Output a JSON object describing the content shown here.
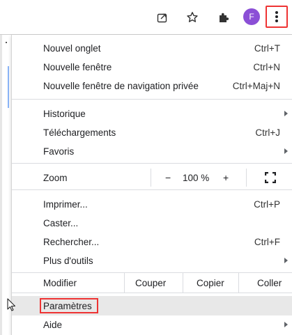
{
  "toolbar": {
    "share_icon": "share-icon",
    "star_icon": "star-icon",
    "extensions_icon": "puzzle-icon",
    "avatar_letter": "F",
    "avatar_color": "#8b4fd6",
    "menu_icon": "kebab-menu-icon"
  },
  "menu": {
    "new_tab": {
      "label": "Nouvel onglet",
      "shortcut": "Ctrl+T"
    },
    "new_window": {
      "label": "Nouvelle fenêtre",
      "shortcut": "Ctrl+N"
    },
    "incognito": {
      "label": "Nouvelle fenêtre de navigation privée",
      "shortcut": "Ctrl+Maj+N"
    },
    "history": {
      "label": "Historique"
    },
    "downloads": {
      "label": "Téléchargements",
      "shortcut": "Ctrl+J"
    },
    "bookmarks": {
      "label": "Favoris"
    },
    "zoom": {
      "label": "Zoom",
      "minus": "−",
      "value": "100 %",
      "plus": "+"
    },
    "print": {
      "label": "Imprimer...",
      "shortcut": "Ctrl+P"
    },
    "cast": {
      "label": "Caster..."
    },
    "find": {
      "label": "Rechercher...",
      "shortcut": "Ctrl+F"
    },
    "more_tools": {
      "label": "Plus d'outils"
    },
    "edit": {
      "label": "Modifier",
      "cut": "Couper",
      "copy": "Copier",
      "paste": "Coller"
    },
    "settings": {
      "label": "Paramètres"
    },
    "help": {
      "label": "Aide"
    }
  },
  "colors": {
    "highlight_border": "#e33",
    "hover_row": "#e8e8e8"
  }
}
